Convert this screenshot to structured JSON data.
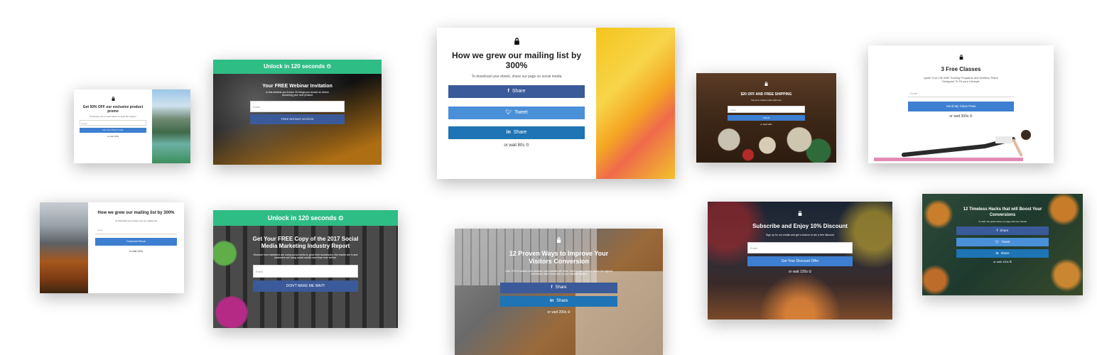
{
  "colors": {
    "share_fb": "#3b5a9a",
    "share_tw": "#4a90d9",
    "share_li": "#1e74b5",
    "btn_blue": "#3d7fd1",
    "banner_green": "#2fbd86"
  },
  "c1": {
    "title": "Get 50% OFF our exclusive product promo",
    "sub": "To access, let us know where to send the coupon",
    "input": "Email",
    "button": "Get Your Promo Code",
    "wait": "or wait 120s"
  },
  "c2": {
    "banner": "Unlock in 120 seconds",
    "title": "Your FREE Webinar Invitation",
    "sub": "In this webinar you'll learn 30 things you should do before launching your next product",
    "input": "Email",
    "button": "FREE INSTANT ACCESS"
  },
  "c3": {
    "title": "How we grew our mailing list by 300%",
    "sub": "To download your ebook, share our page on social media",
    "share": "Share",
    "tweet": "Tweet",
    "linkedin": "Share",
    "wait": "or wait 80s"
  },
  "c4": {
    "title": "$20 OFF AND FREE SHIPPING",
    "sub": "Get your coupon code right now",
    "input": "Email",
    "button": "Submit",
    "wait": "or wait 120s"
  },
  "c5": {
    "title": "3 Free Classes",
    "sub": "Ignite Your Life With Training Programs and Nutrition Plans Designed To Fit your Lifestyle",
    "input": "Email",
    "button": "Send My Class Pass",
    "wait": "or wait 300s"
  },
  "c6": {
    "title": "How we grew our mailing list by 300%",
    "sub": "To download your ebook, join our mailing list",
    "input": "Email",
    "button": "Download Ebook",
    "wait": "or wait 120s"
  },
  "c7": {
    "banner": "Unlock in 120 seconds",
    "title": "Get Your FREE Copy of the 2017 Social Media Marketing Industry Report",
    "sub": "Discover how marketers are using social media to grow their businesses; the results are in and marketers are using social media more than ever before.",
    "input": "Email",
    "button": "DON'T MAKE ME WAIT!"
  },
  "c8": {
    "title": "12 Proven Ways to Improve Your Visitors Conversion",
    "sub": "Over 70% of visitors who abandon your website will never return! Learn how to unlock the highest conversion rates from each of your website visitors",
    "share": "Share",
    "linkedin": "Share",
    "wait": "or wait 200s"
  },
  "c9": {
    "title": "Subscribe and Enjoy 10% Discount",
    "sub": "Sign up for our emails and get a chance to win a free discount",
    "input": "Email",
    "button": "Get Your Discount Offer",
    "wait": "or wait 120s"
  },
  "c10": {
    "title": "12 Timeless Hacks that will Boost Your Conversions",
    "sub": "To claim the guide share our page with your friends",
    "share": "Share",
    "tweet": "Tweet",
    "linkedin": "Share",
    "wait": "or wait 120s"
  }
}
